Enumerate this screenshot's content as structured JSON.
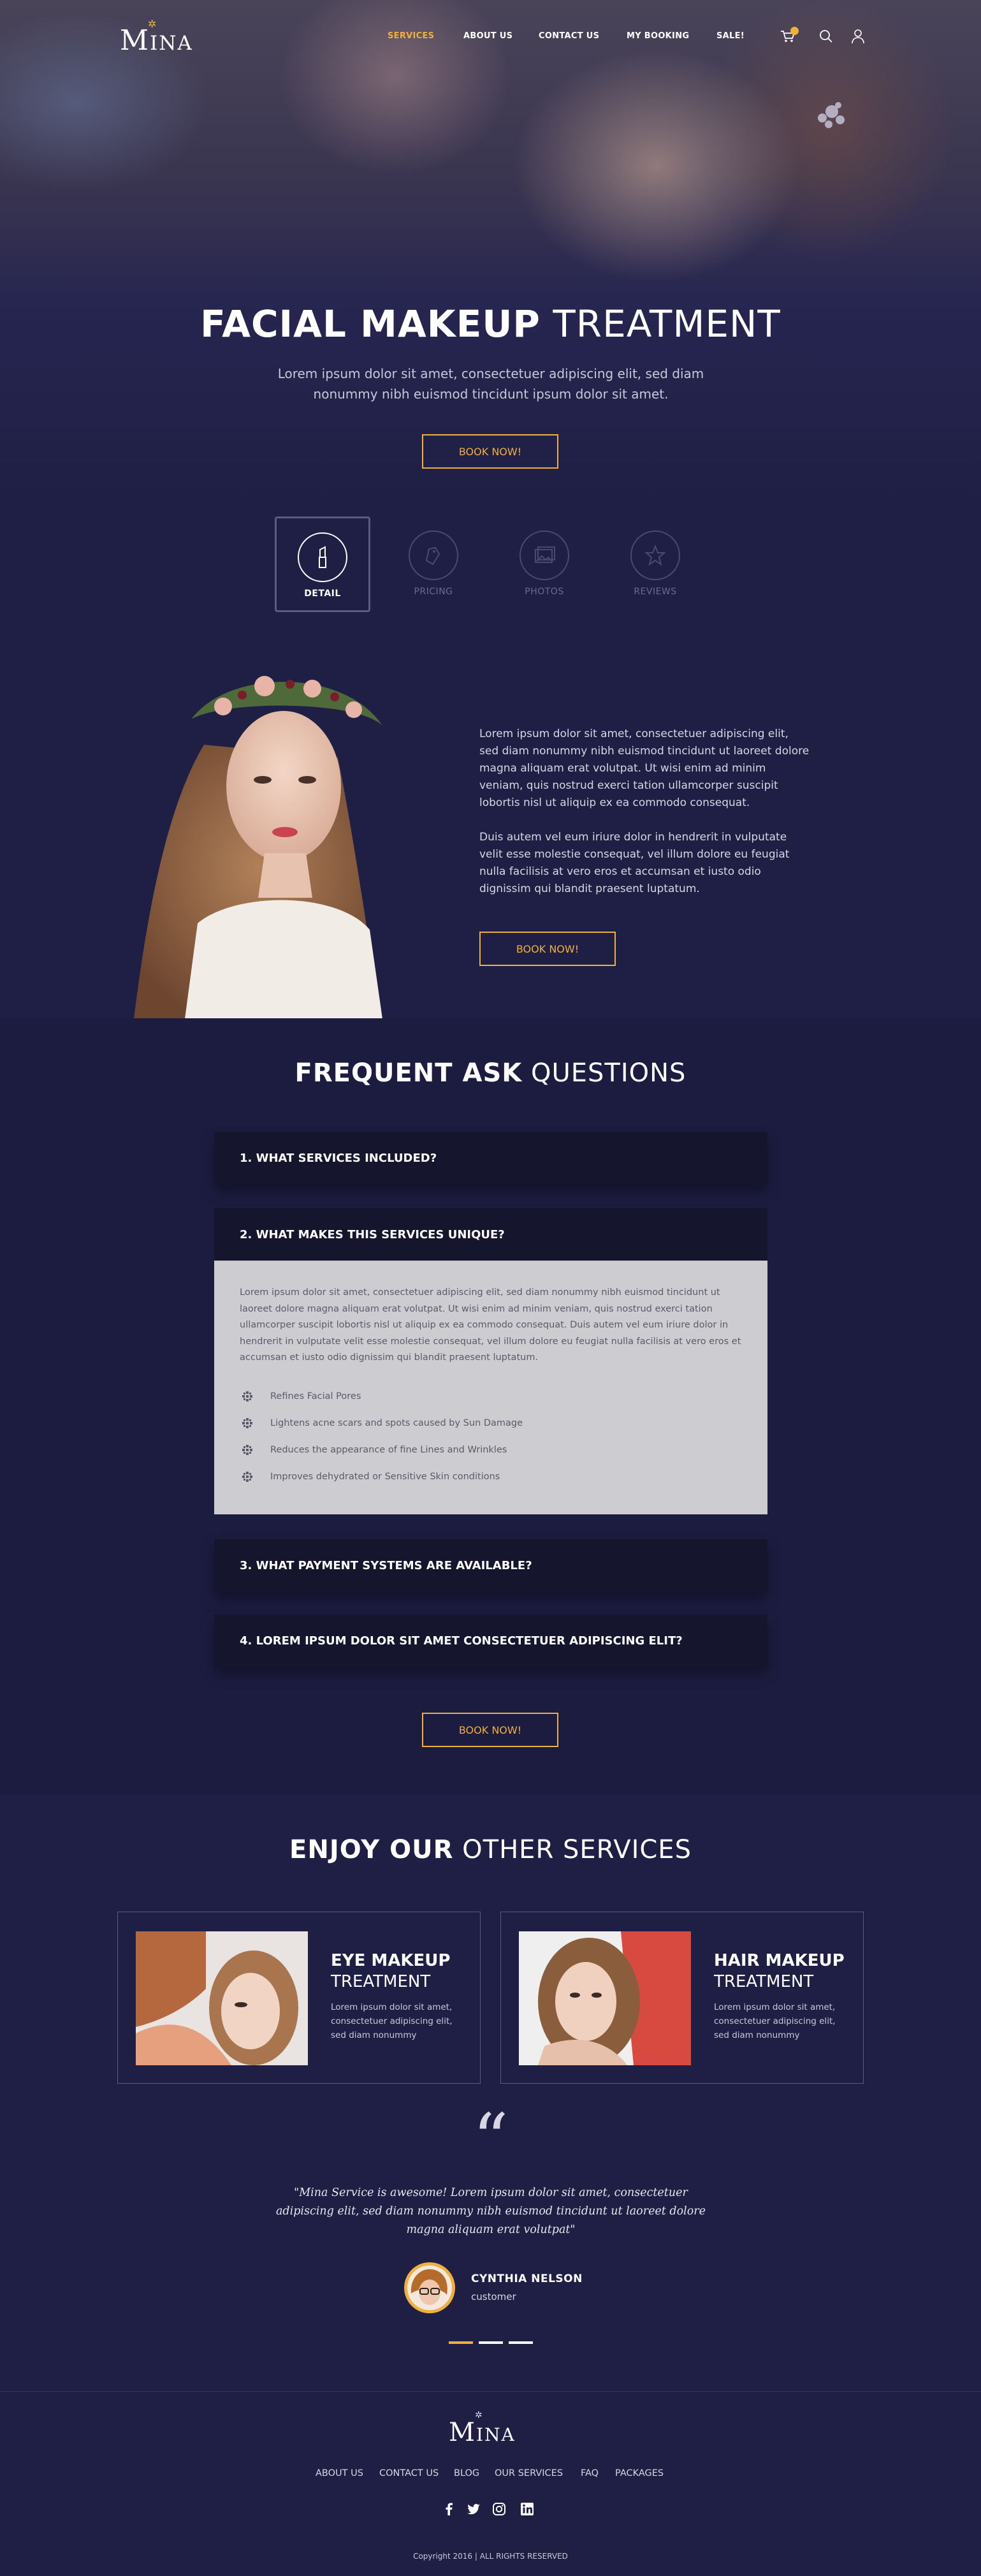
{
  "brand": {
    "name": "Mina"
  },
  "nav": {
    "items": [
      "SERVICES",
      "ABOUT US",
      "CONTACT US",
      "MY BOOKING",
      "SALE!"
    ],
    "active": "SERVICES"
  },
  "hero": {
    "title_bold": "FACIAL MAKEUP",
    "title_light": "TREATMENT",
    "subtitle": "Lorem ipsum dolor sit amet, consectetuer adipiscing elit, sed diam nonummy nibh euismod tincidunt ipsum dolor sit amet.",
    "cta": "BOOK NOW!"
  },
  "tabs": [
    {
      "label": "DETAIL",
      "icon": "lipstick-icon",
      "active": true
    },
    {
      "label": "PRICING",
      "icon": "price-tag-icon",
      "active": false
    },
    {
      "label": "PHOTOS",
      "icon": "photos-icon",
      "active": false
    },
    {
      "label": "REVIEWS",
      "icon": "star-icon",
      "active": false
    }
  ],
  "detail": {
    "para1": "Lorem ipsum dolor sit amet, consectetuer adipiscing elit, sed diam nonummy nibh euismod tincidunt ut laoreet dolore magna aliquam erat volutpat. Ut wisi enim ad minim veniam, quis nostrud exerci tation ullamcorper suscipit lobortis nisl ut aliquip ex ea commodo consequat.",
    "para2": "Duis autem vel eum iriure dolor in hendrerit in vulputate velit esse molestie consequat, vel illum dolore eu feugiat nulla facilisis at vero eros et accumsan et iusto odio dignissim qui blandit praesent luptatum.",
    "cta": "BOOK NOW!"
  },
  "faq": {
    "title_bold": "FREQUENT ASK",
    "title_light": "QUESTIONS",
    "questions": [
      "1. WHAT SERVICES INCLUDED?",
      "2. WHAT MAKES THIS SERVICES UNIQUE?",
      "3. WHAT PAYMENT SYSTEMS ARE AVAILABLE?",
      "4. LOREM IPSUM DOLOR SIT AMET CONSECTETUER ADIPISCING ELIT?"
    ],
    "answer": "Lorem ipsum dolor sit amet, consectetuer adipiscing elit, sed diam nonummy nibh euismod tincidunt ut laoreet dolore magna aliquam erat volutpat. Ut wisi enim ad minim veniam, quis nostrud exerci tation ullamcorper suscipit lobortis nisl ut aliquip ex ea commodo consequat. Duis autem vel eum iriure dolor in hendrerit in vulputate velit esse molestie consequat, vel illum dolore eu feugiat nulla facilisis at vero eros et accumsan et iusto odio dignissim qui blandit praesent luptatum.",
    "answer_list": [
      "Refines Facial Pores",
      "Lightens acne scars and spots caused by Sun Damage",
      "Reduces the appearance of fine Lines and Wrinkles",
      "Improves dehydrated or Sensitive Skin conditions"
    ],
    "cta": "BOOK NOW!"
  },
  "services": {
    "title_bold": "ENJOY OUR",
    "title_light": "OTHER SERVICES",
    "cards": [
      {
        "title_bold": "EYE MAKEUP",
        "title_light": "TREATMENT",
        "desc": "Lorem ipsum dolor sit amet, consectetuer adipiscing elit, sed diam nonummy"
      },
      {
        "title_bold": "HAIR MAKEUP",
        "title_light": "TREATMENT",
        "desc": "Lorem ipsum dolor sit amet, consectetuer adipiscing elit, sed diam nonummy"
      }
    ]
  },
  "testimonial": {
    "quote_mark": "“",
    "text": "\"Mina Service is awesome! Lorem ipsum dolor sit amet, consectetuer adipiscing elit, sed diam nonummy nibh euismod tincidunt ut laoreet dolore magna aliquam erat volutpat\"",
    "name": "CYNTHIA NELSON",
    "role": "customer"
  },
  "footer": {
    "links": [
      "ABOUT US",
      "CONTACT US",
      "BLOG",
      "OUR SERVICES",
      "FAQ",
      "PACKAGES"
    ],
    "social": [
      "facebook-icon",
      "twitter-icon",
      "instagram-icon",
      "linkedin-icon"
    ],
    "copyright": "Copyright 2016 | ALL RIGHTS RESERVED"
  },
  "colors": {
    "accent": "#f0b03c",
    "background": "#1f1f45",
    "panel": "#15152e",
    "answer_bg": "#cdccd0"
  }
}
